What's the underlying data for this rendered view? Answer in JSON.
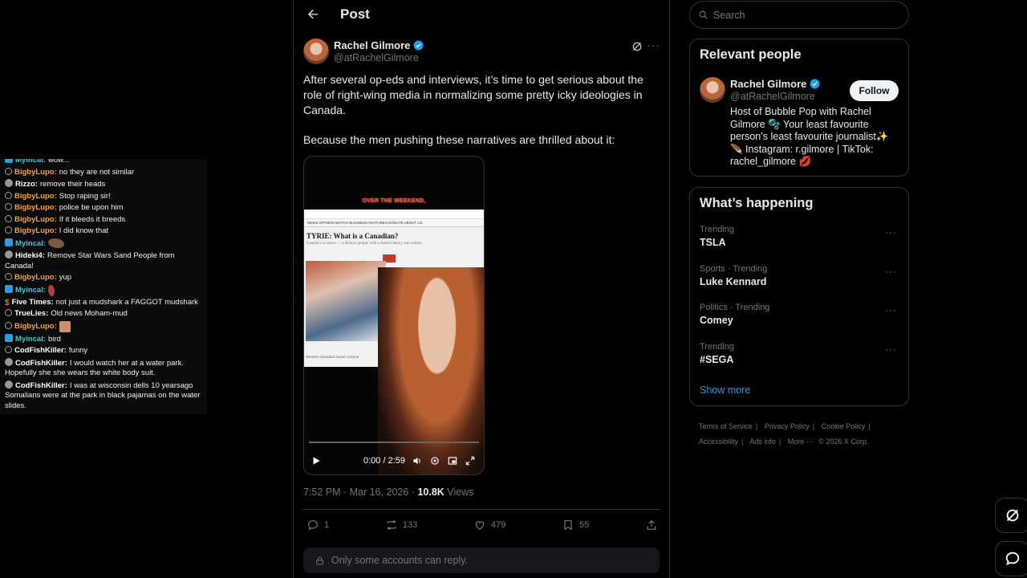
{
  "chat": {
    "lines": [
      {
        "badge": "mod",
        "name": "Myincal:",
        "color": "cyan",
        "text": "wow..."
      },
      {
        "badge": "user",
        "name": "BigbyLupo:",
        "color": "orange",
        "text": "no they are not similar"
      },
      {
        "badge": "avatar",
        "name": "Rizzo:",
        "color": "white",
        "text": "remove their heads"
      },
      {
        "badge": "user",
        "name": "BigbyLupo:",
        "color": "orange",
        "text": "Stop raping sir!"
      },
      {
        "badge": "user",
        "name": "BigbyLupo:",
        "color": "orange",
        "text": "police be upon him"
      },
      {
        "badge": "user",
        "name": "BigbyLupo:",
        "color": "orange",
        "text": "If it bleeds it breeds"
      },
      {
        "badge": "user",
        "name": "BigbyLupo:",
        "color": "orange",
        "text": "I did know that"
      },
      {
        "badge": "mod",
        "name": "Myincal:",
        "color": "cyan",
        "text": "",
        "emote": "bread"
      },
      {
        "badge": "avatar",
        "name": "Hideki4:",
        "color": "white",
        "text": "Remove Star Wars Sand People from Canada!"
      },
      {
        "badge": "user",
        "name": "BigbyLupo:",
        "color": "orange",
        "text": "yup"
      },
      {
        "badge": "mod",
        "name": "Myincal:",
        "color": "cyan",
        "text": "",
        "emote": "tall"
      },
      {
        "badge": "gold",
        "name": "Five Times:",
        "color": "white",
        "text": "not just a mudshark a FAGGOT mudshark"
      },
      {
        "badge": "user",
        "name": "TrueLies:",
        "color": "white",
        "text": "Old news Moham-mud"
      },
      {
        "badge": "user",
        "name": "BigbyLupo:",
        "color": "orange",
        "text": "",
        "emote": "face"
      },
      {
        "badge": "mod",
        "name": "Myincal:",
        "color": "cyan",
        "text": "bird"
      },
      {
        "badge": "user",
        "name": "CodFishKiller:",
        "color": "white",
        "text": "funny"
      },
      {
        "badge": "avatar",
        "name": "CodFishKiller:",
        "color": "white",
        "text": "I would watch her at a water park. Hopefully she she wears the white body suit."
      },
      {
        "badge": "avatar",
        "name": "CodFishKiller:",
        "color": "white",
        "text": "I was at wisconsin dells 10 yearsago Somalians were at the park in black pajamas on the water slides."
      }
    ]
  },
  "header": {
    "title": "Post"
  },
  "post": {
    "author_name": "Rachel Gilmore",
    "author_handle": "@atRachelGilmore",
    "text_p1": "After several op-eds and interviews, it’s time to get serious about the role of right-wing media in normalizing some pretty icky ideologies in Canada.",
    "text_p2": "Because the men pushing these narratives are thrilled about it:",
    "media": {
      "banner": "OVER THE WEEKEND,",
      "nav": "NEWS   OPINION   WATCH   BUSINESS   FEATURES   DONATE   ABOUT US",
      "headline": "TYRIE: What is a Canadian?",
      "sub": "Canada is a nation — a distinct people with a shared history and culture",
      "foot": "Western Standard Guest Column",
      "time": "0:00 / 2:59",
      "progress": 0
    },
    "time": "7:52 PM · Mar 16, 2026 · ",
    "views_count": "10.8K",
    "views_label": " Views",
    "replies": "1",
    "reposts": "133",
    "likes": "479",
    "bookmarks": "55",
    "reply_notice": "Only some accounts can reply."
  },
  "search": {
    "placeholder": "Search"
  },
  "relevant_people": {
    "title": "Relevant people",
    "name": "Rachel Gilmore",
    "handle": "@atRachelGilmore",
    "follow_label": "Follow",
    "bio": "Host of Bubble Pop with Rachel Gilmore 🫧 Your least favourite person’s least favourite journalist✨ 🪶 Instagram: r.gilmore | TikTok: rachel_gilmore 💋"
  },
  "whats_happening": {
    "title": "What’s happening",
    "trends": [
      {
        "meta": "Trending",
        "name": "TSLA"
      },
      {
        "meta": "Sports · Trending",
        "name": "Luke Kennard"
      },
      {
        "meta": "Politics · Trending",
        "name": "Comey"
      },
      {
        "meta": "Trending",
        "name": "#SEGA"
      }
    ],
    "show_more": "Show more"
  },
  "footer": {
    "links": [
      "Terms of Service",
      "Privacy Policy",
      "Cookie Policy",
      "Accessibility",
      "Ads info",
      "More ···"
    ],
    "copyright": "© 2026 X Corp."
  },
  "colors": {
    "accent": "#1d9bf0",
    "background": "#000000",
    "border": "#2f3336",
    "muted": "#71767b"
  }
}
